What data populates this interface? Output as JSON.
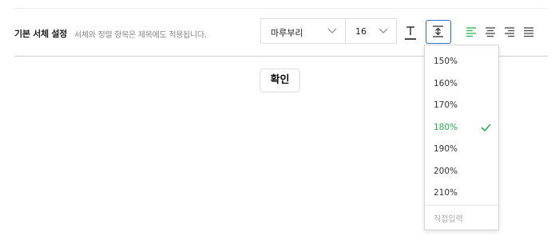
{
  "settings": {
    "title": "기본 서체 설정",
    "description": "서체와 정렬 항목은 제목에도 적용됩니다."
  },
  "toolbar": {
    "font_family": "마루부리",
    "font_size": "16",
    "tools": [
      "underline-icon",
      "line-height-icon",
      "align-left-icon",
      "align-center-icon",
      "align-right-icon",
      "align-justify-icon"
    ],
    "active_tool": "line-height-icon",
    "active_align": "align-left-icon"
  },
  "line_height_menu": {
    "options": [
      "150%",
      "160%",
      "170%",
      "180%",
      "190%",
      "200%",
      "210%"
    ],
    "selected": "180%",
    "custom_label": "직접입력"
  },
  "confirm_label": "확인",
  "colors": {
    "accent_green": "#2bb24c",
    "focus_blue": "#2b6fd6",
    "border": "#dcdcdc"
  }
}
